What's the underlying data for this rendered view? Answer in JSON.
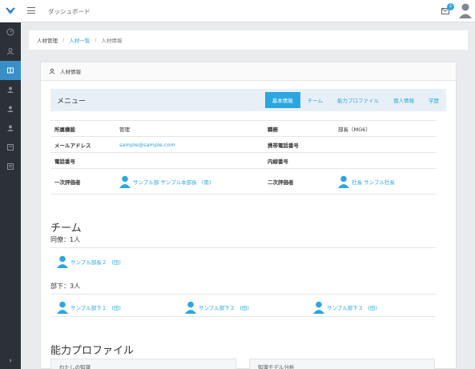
{
  "app": {
    "title": "ダッシュボード",
    "unread_count": "2"
  },
  "sidebar": {
    "items": [
      {
        "icon": "speedometer-icon"
      },
      {
        "icon": "users-icon"
      },
      {
        "icon": "book-icon",
        "active": true
      },
      {
        "icon": "user-icon-1"
      },
      {
        "icon": "user-icon-2"
      },
      {
        "icon": "user-icon-3"
      },
      {
        "icon": "report-icon"
      },
      {
        "icon": "list-icon"
      }
    ],
    "expand_glyph": "›"
  },
  "breadcrumb": {
    "root": "人材管理",
    "sep": "/",
    "list": "人材一覧",
    "current": "人材情報"
  },
  "panel": {
    "title": "人材情報",
    "menu_label": "メニュー",
    "tabs": [
      "基本情報",
      "チーム",
      "能力プロファイル",
      "個人情報",
      "学歴"
    ],
    "active_tab": "基本情報"
  },
  "info": {
    "department_label": "所属機能",
    "department_value": "管理",
    "position_label": "職務",
    "position_value": "部長（MG6）",
    "email_label": "メールアドレス",
    "email_value": "sample@sample.com",
    "mobile_label": "携帯電話番号",
    "mobile_value": "",
    "phone_label": "電話番号",
    "phone_value": "",
    "extension_label": "内線番号",
    "extension_value": "",
    "first_eval_label": "一次評価者",
    "first_eval_name": "サンプル部 サンプル本部長",
    "first_eval_ref": "(雨)",
    "second_eval_label": "二次評価者",
    "second_eval_name": "社長 サンプル社長"
  },
  "team": {
    "title": "チーム",
    "peers_label": "同僚：1人",
    "peers": [
      {
        "name": "サンプル部長２",
        "ref": "(田)"
      }
    ],
    "subordinates_label": "部下：3人",
    "subordinates": [
      {
        "name": "サンプル部下１",
        "ref": "(田)"
      },
      {
        "name": "サンプル部下２",
        "ref": "(田)"
      },
      {
        "name": "サンプル部下３",
        "ref": "(田)"
      }
    ]
  },
  "ability": {
    "title": "能力プロファイル",
    "card_left": "わたしの知識",
    "card_right": "知識モデル分析"
  },
  "colors": {
    "accent": "#2aa7e0",
    "sidebar": "#2c3138"
  }
}
